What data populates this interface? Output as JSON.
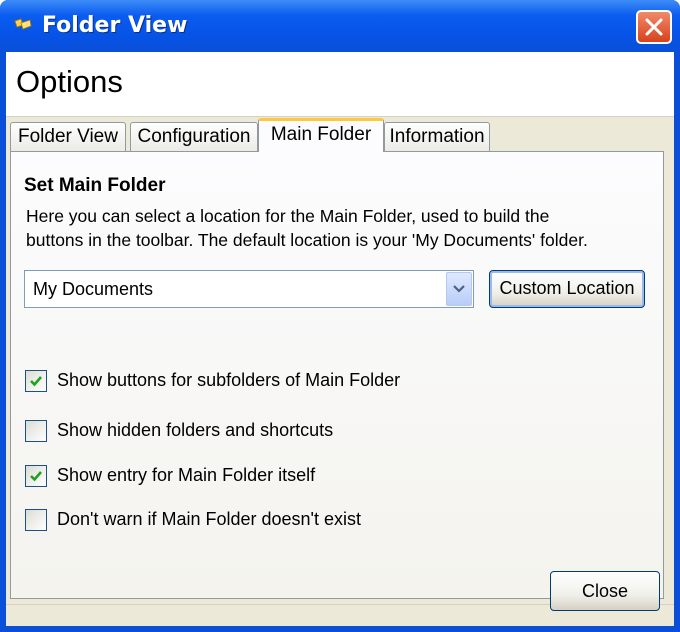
{
  "window": {
    "title": "Folder View",
    "colors": {
      "titlebar": "#0a4fd8",
      "close": "#d8421c",
      "tab_highlight": "#ffc83c",
      "check": "#21a121"
    }
  },
  "header": {
    "title": "Options"
  },
  "tabs": [
    {
      "label": "Folder View",
      "active": false
    },
    {
      "label": "Configuration",
      "active": false
    },
    {
      "label": "Main Folder",
      "active": true
    },
    {
      "label": "Information",
      "active": false
    }
  ],
  "main": {
    "section_title": "Set Main Folder",
    "description_line1": "Here you can select a location for the Main Folder, used to build the",
    "description_line2": "buttons in the toolbar. The default location is your 'My Documents' folder.",
    "location": {
      "value": "My Documents"
    },
    "custom_location_button": "Custom Location",
    "options": [
      {
        "label": "Show buttons for subfolders of Main Folder",
        "checked": true
      },
      {
        "label": "Show hidden folders and shortcuts",
        "checked": false
      },
      {
        "label": "Show entry for Main Folder itself",
        "checked": true
      },
      {
        "label": "Don't warn if Main Folder doesn't exist",
        "checked": false
      }
    ]
  },
  "footer": {
    "close_button": "Close"
  }
}
